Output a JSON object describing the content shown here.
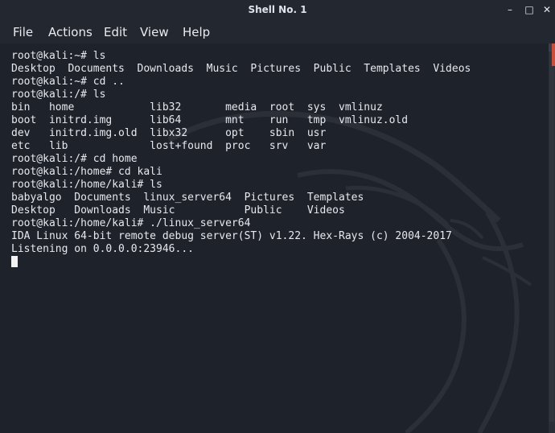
{
  "window": {
    "title": "Shell No. 1",
    "controls": {
      "minimize": "–",
      "maximize": "□",
      "close": "✕"
    }
  },
  "menu": {
    "file": "File",
    "actions": "Actions",
    "edit": "Edit",
    "view": "View",
    "help": "Help"
  },
  "terminal": {
    "lines": [
      "root@kali:~# ls",
      "Desktop  Documents  Downloads  Music  Pictures  Public  Templates  Videos",
      "root@kali:~# cd ..",
      "root@kali:/# ls",
      "bin   home            lib32       media  root  sys  vmlinuz",
      "boot  initrd.img      lib64       mnt    run   tmp  vmlinuz.old",
      "dev   initrd.img.old  libx32      opt    sbin  usr",
      "etc   lib             lost+found  proc   srv   var",
      "root@kali:/# cd home",
      "root@kali:/home# cd kali",
      "root@kali:/home/kali# ls",
      "babyalgo  Documents  linux_server64  Pictures  Templates",
      "Desktop   Downloads  Music           Public    Videos",
      "root@kali:/home/kali# ./linux_server64",
      "IDA Linux 64-bit remote debug server(ST) v1.22. Hex-Rays (c) 2004-2017",
      "Listening on 0.0.0.0:23946..."
    ],
    "text": ""
  },
  "colors": {
    "background": "#1e222a",
    "titlebar": "#23272f",
    "text": "#e7e9ee",
    "watermark": "#2b3038",
    "accent": "#c94f3b"
  },
  "icons": {
    "minimize": "minimize-icon",
    "maximize": "maximize-icon",
    "close": "close-icon",
    "watermark": "kali-dragon-icon"
  }
}
